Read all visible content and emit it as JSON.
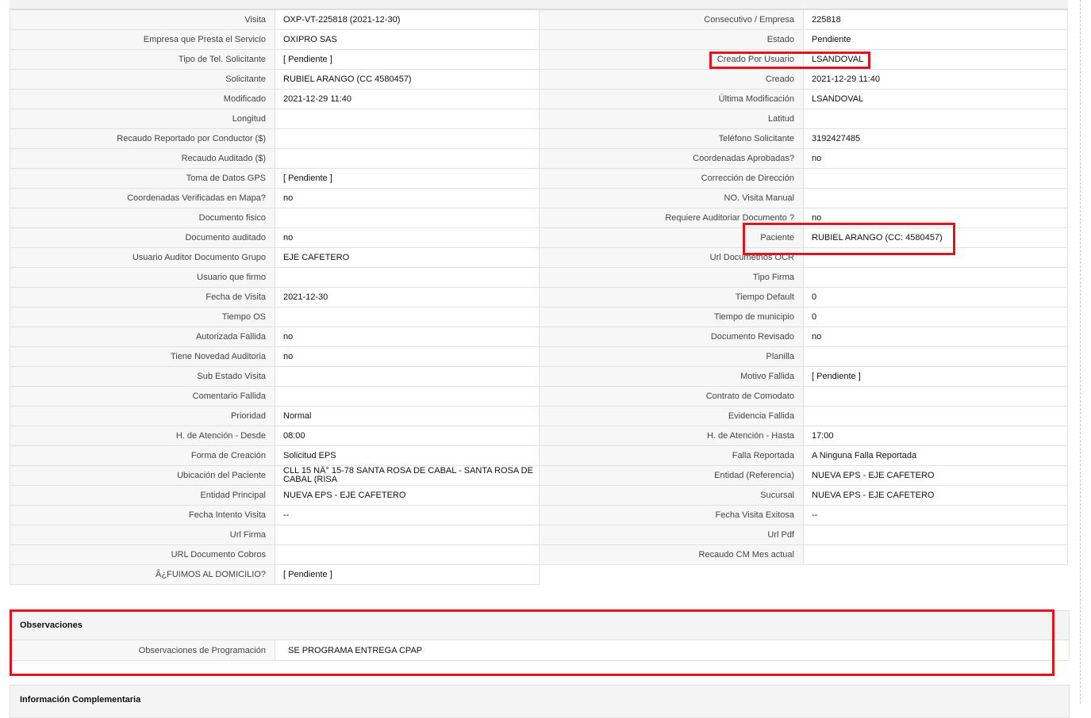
{
  "left_fields": [
    {
      "label": "Visita",
      "value": "OXP-VT-225818 (2021-12-30)"
    },
    {
      "label": "Empresa que Presta el Servicio",
      "value": "OXIPRO SAS"
    },
    {
      "label": "Tipo de Tel. Solicitante",
      "value": "[ Pendiente ]"
    },
    {
      "label": "Solicitante",
      "value": "RUBIEL ARANGO (CC 4580457)"
    },
    {
      "label": "Modificado",
      "value": "2021-12-29 11:40"
    },
    {
      "label": "Longitud",
      "value": ""
    },
    {
      "label": "Recaudo Reportado por Conductor ($)",
      "value": ""
    },
    {
      "label": "Recaudo Auditado ($)",
      "value": ""
    },
    {
      "label": "Toma de Datos GPS",
      "value": "[ Pendiente ]"
    },
    {
      "label": "Coordenadas Verificadas en Mapa?",
      "value": " no"
    },
    {
      "label": "Documento fisico",
      "value": ""
    },
    {
      "label": "Documento auditado",
      "value": " no"
    },
    {
      "label": "Usuario Auditor Documento Grupo",
      "value": "EJE CAFETERO"
    },
    {
      "label": "Usuario que firmo",
      "value": ""
    },
    {
      "label": "Fecha de Visita",
      "value": " 2021-12-30"
    },
    {
      "label": "Tiempo OS",
      "value": ""
    },
    {
      "label": "Autorizada Fallida",
      "value": " no"
    },
    {
      "label": "Tiene Novedad Auditoria",
      "value": " no"
    },
    {
      "label": "Sub Estado Visita",
      "value": ""
    },
    {
      "label": "Comentario Fallida",
      "value": ""
    },
    {
      "label": "Prioridad",
      "value": "Normal"
    },
    {
      "label": "H. de Atención - Desde",
      "value": "08:00"
    },
    {
      "label": "Forma de Creación",
      "value": "Solicitud EPS"
    },
    {
      "label": "Ubicación del Paciente",
      "value": "CLL 15 NÂ° 15-78 SANTA ROSA DE CABAL - SANTA ROSA DE CABAL (RISA"
    },
    {
      "label": "Entidad Principal",
      "value": "NUEVA EPS - EJE CAFETERO"
    },
    {
      "label": "Fecha Intento Visita",
      "value": " --"
    },
    {
      "label": "Url Firma",
      "value": ""
    },
    {
      "label": "URL Documento Cobros",
      "value": ""
    },
    {
      "label": "Â¿FUIMOS AL DOMICILIO?",
      "value": "[ Pendiente ]"
    }
  ],
  "right_fields": [
    {
      "label": "Consecutivo / Empresa",
      "value": "225818"
    },
    {
      "label": "Estado",
      "value": "Pendiente"
    },
    {
      "label": "Creado Por Usuario",
      "value": "LSANDOVAL"
    },
    {
      "label": "Creado",
      "value": "2021-12-29 11:40"
    },
    {
      "label": "Última Modificación",
      "value": " LSANDOVAL"
    },
    {
      "label": "Latitud",
      "value": ""
    },
    {
      "label": "Teléfono Solicitante",
      "value": "3192427485"
    },
    {
      "label": "Coordenadas Aprobadas?",
      "value": " no"
    },
    {
      "label": "Corrección de Dirección",
      "value": ""
    },
    {
      "label": "NO. Visita Manual",
      "value": ""
    },
    {
      "label": "Requiere Auditoriar Documento ?",
      "value": " no"
    },
    {
      "label": "Paciente",
      "value": "RUBIEL ARANGO (CC: 4580457)"
    },
    {
      "label": "Url Documetnos OCR",
      "value": ""
    },
    {
      "label": "Tipo Firma",
      "value": ""
    },
    {
      "label": "Tiempo Default",
      "value": "0"
    },
    {
      "label": "Tiempo de municipio",
      "value": "0"
    },
    {
      "label": "Documento Revisado",
      "value": " no"
    },
    {
      "label": "Planilla",
      "value": ""
    },
    {
      "label": "Motivo Fallida",
      "value": "[ Pendiente ]"
    },
    {
      "label": "Contrato de Comodato",
      "value": ""
    },
    {
      "label": "Evidencia Fallida",
      "value": ""
    },
    {
      "label": "H. de Atención - Hasta",
      "value": "17:00"
    },
    {
      "label": "Falla Reportada",
      "value": "A Ninguna Falla Reportada"
    },
    {
      "label": "Entidad (Referencia)",
      "value": "NUEVA EPS - EJE CAFETERO"
    },
    {
      "label": "Sucursal",
      "value": "NUEVA EPS - EJE CAFETERO"
    },
    {
      "label": "Fecha Visita Exitosa",
      "value": " --"
    },
    {
      "label": "Url Pdf",
      "value": ""
    },
    {
      "label": "Recaudo CM Mes actual",
      "value": ""
    }
  ],
  "observaciones": {
    "title": "Observaciones",
    "label": "Observaciones de Programación",
    "value": "SE PROGRAMA ENTREGA CPAP"
  },
  "info_complementaria": {
    "title": "Información Complementaria"
  },
  "highlight_color": "#e0141e"
}
